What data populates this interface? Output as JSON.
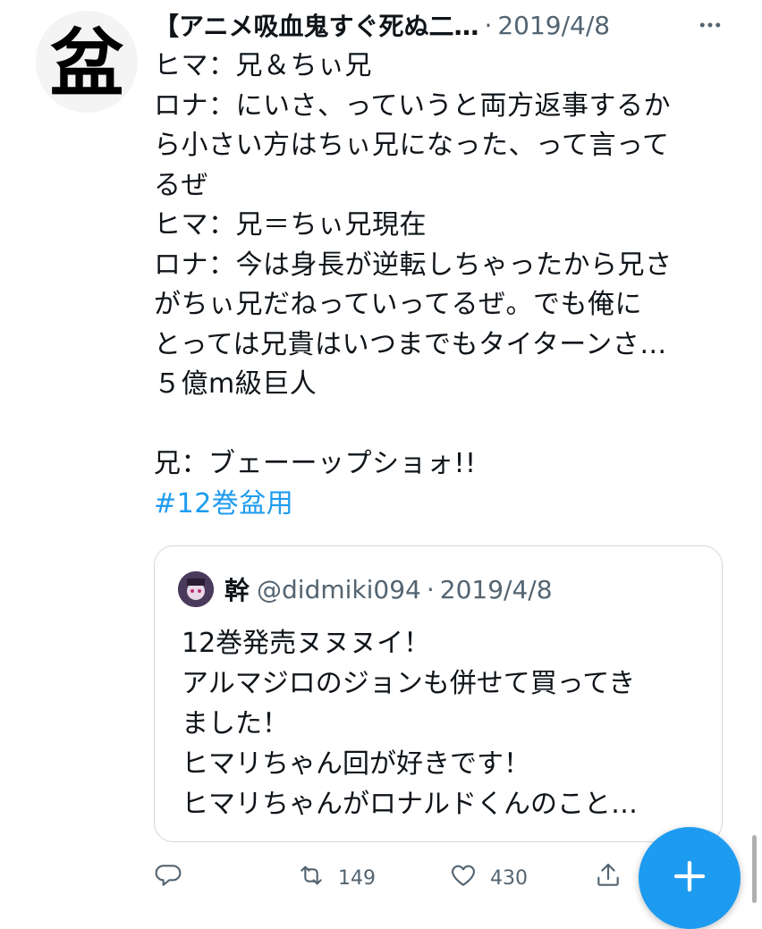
{
  "tweet": {
    "display_name": "【アニメ吸血鬼すぐ死ぬ二…",
    "separator": "·",
    "date": "2019/4/8",
    "lines": [
      "ヒマ：兄＆ちぃ兄",
      "ロナ：にいさ、っていうと両方返事するか",
      "ら小さい方はちぃ兄になった、って言って",
      "るぜ",
      "ヒマ：兄＝ちぃ兄現在",
      "ロナ：今は身長が逆転しちゃったから兄さ",
      "がちぃ兄だねっていってるぜ。でも俺に",
      "とっては兄貴はいつまでもタイターンさ…",
      "５億m級巨人"
    ],
    "last_line": "兄：ブェーーップショォ!!",
    "hashtag": "#12巻盆用",
    "avatar_glyph": "盆"
  },
  "quote": {
    "name": "幹",
    "handle": "@didmiki094",
    "separator": "·",
    "date": "2019/4/8",
    "lines": [
      "12巻発売ヌヌヌイ！",
      "アルマジロのジョンも併せて買ってき",
      "ました！",
      "ヒマリちゃん回が好きです！",
      "ヒマリちゃんがロナルドくんのこと…"
    ]
  },
  "actions": {
    "reply_icon": "reply-icon",
    "retweet_icon": "retweet-icon",
    "retweet_count": "149",
    "like_icon": "heart-icon",
    "like_count": "430",
    "share_icon": "share-icon"
  },
  "fab": {
    "icon": "plus-icon",
    "color": "#1d9bf0"
  },
  "colors": {
    "link": "#1d9bf0",
    "muted": "#536471",
    "text": "#0f1419",
    "border": "#cfd9de"
  }
}
